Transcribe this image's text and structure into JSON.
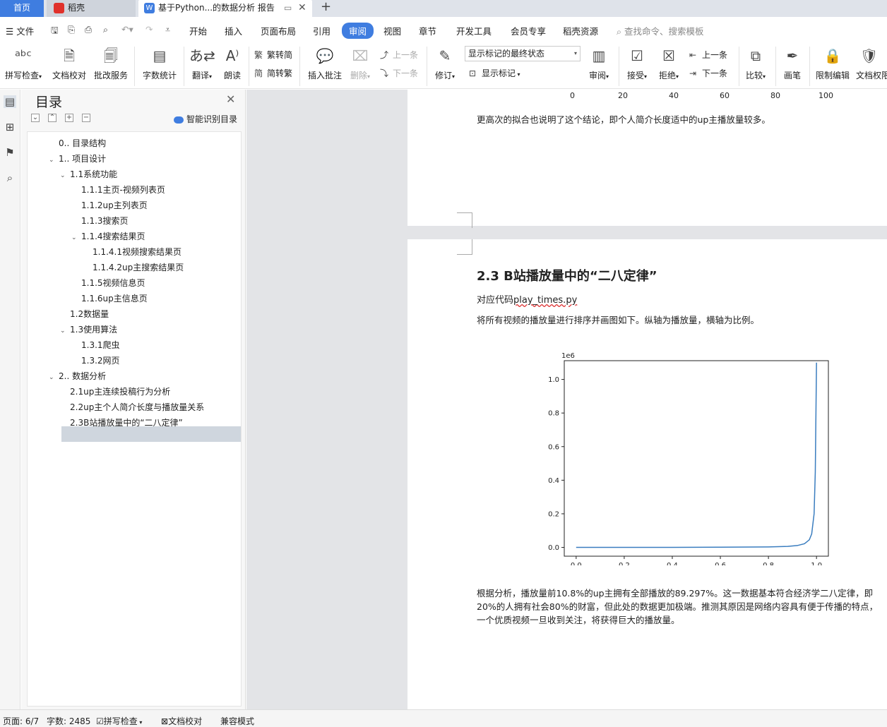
{
  "tabs": {
    "home": "首页",
    "daoke": "稻壳",
    "doc": "基于Python...的数据分析 报告"
  },
  "menu": {
    "file": "文件",
    "items": [
      "开始",
      "插入",
      "页面布局",
      "引用",
      "审阅",
      "视图",
      "章节",
      "开发工具",
      "会员专享",
      "稻壳资源"
    ],
    "search_placeholder": "查找命令、搜索模板"
  },
  "ribbon": {
    "spell": "拼写检查",
    "proof": "文档校对",
    "correct": "批改服务",
    "wordcount": "字数统计",
    "translate": "翻译",
    "read": "朗读",
    "trad": "繁转简",
    "simp": "简转繁",
    "insert_comment": "插入批注",
    "delete": "删除",
    "prev": "上一条",
    "next": "下一条",
    "revise": "修订",
    "markup_state": "显示标记的最终状态",
    "show_markup": "显示标记",
    "review": "审阅",
    "accept": "接受",
    "reject": "拒绝",
    "prev2": "上一条",
    "next2": "下一条",
    "compare": "比较",
    "pen": "画笔",
    "restrict": "限制编辑",
    "doc_perm": "文档权限"
  },
  "nav": {
    "title": "目录",
    "ai_toc": "智能识别目录",
    "items": [
      {
        "label": "0.. 目录结构"
      },
      {
        "label": "1.. 项目设计"
      },
      {
        "label": "1.1系统功能"
      },
      {
        "label": "1.1.1主页-视频列表页"
      },
      {
        "label": "1.1.2up主列表页"
      },
      {
        "label": "1.1.3搜索页"
      },
      {
        "label": "1.1.4搜索结果页"
      },
      {
        "label": "1.1.4.1视频搜索结果页"
      },
      {
        "label": "1.1.4.2up主搜索结果页"
      },
      {
        "label": "1.1.5视频信息页"
      },
      {
        "label": "1.1.6up主信息页"
      },
      {
        "label": "1.2数据量"
      },
      {
        "label": "1.3使用算法"
      },
      {
        "label": "1.3.1爬虫"
      },
      {
        "label": "1.3.2网页"
      },
      {
        "label": "2.. 数据分析"
      },
      {
        "label": "2.1up主连续投稿行为分析"
      },
      {
        "label": "2.2up主个人简介长度与播放量关系"
      },
      {
        "label": "2.3B站播放量中的“二八定律”"
      }
    ]
  },
  "doc": {
    "prev_ticks": [
      "0",
      "20",
      "40",
      "60",
      "80",
      "100"
    ],
    "prev_para": "更高次的拟合也说明了这个结论，即个人简介长度适中的up主播放量较多。",
    "heading": "2.3  B站播放量中的“二八定律”",
    "code_prefix": "对应代码",
    "code_file": "play_times.py",
    "intro": "将所有视频的播放量进行排序并画图如下。纵轴为播放量，横轴为比例。",
    "conclusion": [
      "根据分析，播放量前10.8%的up主拥有全部播放的89.297%。这一数据基本符合经济学二八定律，即",
      "20%的人拥有社会80%的财富，但此处的数据更加极端。推测其原因是网络内容具有便于传播的特点，",
      "一个优质视频一旦收到关注，将获得巨大的播放量。"
    ]
  },
  "chart_data": {
    "type": "line",
    "title": "",
    "xlabel": "",
    "ylabel": "",
    "y_offset_label": "1e6",
    "xlim": [
      0,
      1.0
    ],
    "ylim": [
      0,
      1.1
    ],
    "xticks": [
      "0.0",
      "0.2",
      "0.4",
      "0.6",
      "0.8",
      "1.0"
    ],
    "yticks": [
      "0.0",
      "0.2",
      "0.4",
      "0.6",
      "0.8",
      "1.0"
    ],
    "series": [
      {
        "color": "#3a7dbf",
        "x": [
          0.0,
          0.2,
          0.4,
          0.6,
          0.8,
          0.88,
          0.92,
          0.95,
          0.97,
          0.98,
          0.99,
          0.995,
          1.0
        ],
        "y": [
          0.0,
          0.0,
          0.0,
          0.001,
          0.003,
          0.006,
          0.011,
          0.022,
          0.045,
          0.08,
          0.2,
          0.45,
          1.1
        ]
      }
    ]
  },
  "status": {
    "page": "页面: 6/7",
    "words": "字数: 2485",
    "spell": "拼写检查",
    "proof": "文档校对",
    "compat": "兼容模式"
  }
}
